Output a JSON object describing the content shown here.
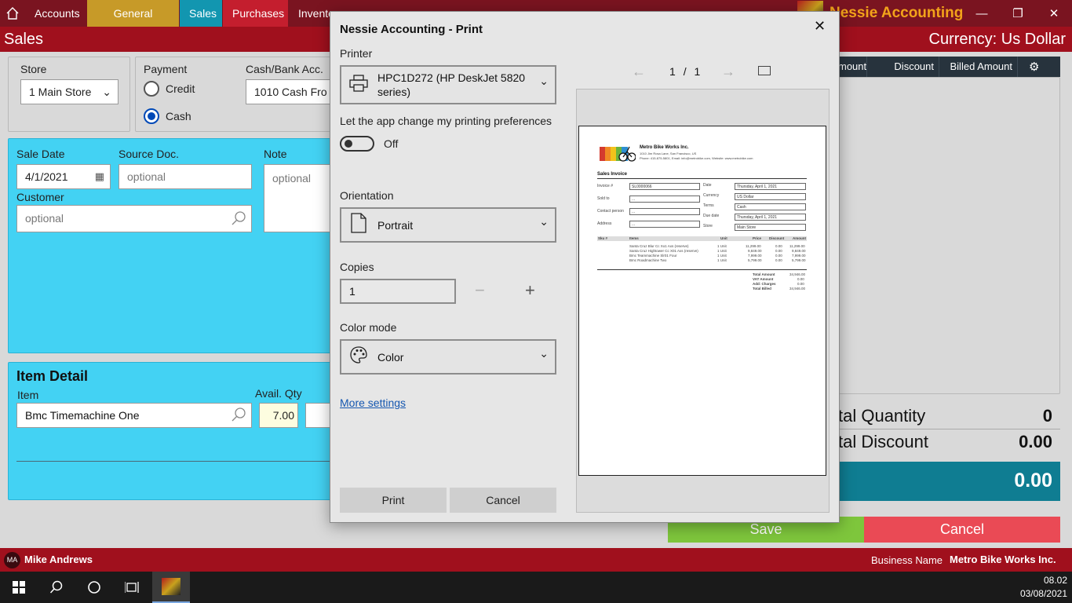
{
  "nav": {
    "items": [
      {
        "label": "Accounts",
        "bg": "#7a1420"
      },
      {
        "label": "General Journal",
        "bg": "#c79a28"
      },
      {
        "label": "Sales",
        "bg": "#1296b0"
      },
      {
        "label": "Purchases",
        "bg": "#c41e2e"
      },
      {
        "label": "Invento",
        "bg": "#7a1420"
      }
    ],
    "brand": "Nessie Accounting"
  },
  "header": {
    "title": "Sales",
    "currency": "Currency: Us Dollar"
  },
  "store": {
    "label": "Store",
    "value": "1  Main Store"
  },
  "payment": {
    "label": "Payment",
    "credit": "Credit",
    "cash": "Cash",
    "cash_acc_label": "Cash/Bank Acc.",
    "cash_acc_value": "1010   Cash Fro"
  },
  "sale": {
    "date_label": "Sale Date",
    "date_value": "4/1/2021",
    "source_label": "Source Doc.",
    "source_placeholder": "optional",
    "note_label": "Note",
    "note_placeholder": "optional",
    "customer_label": "Customer",
    "customer_placeholder": "optional"
  },
  "item_detail": {
    "title": "Item Detail",
    "item_label": "Item",
    "item_value": "Bmc Timemachine One",
    "avail_label": "Avail. Qty",
    "avail_value": "7.00"
  },
  "grid": {
    "headers": [
      "mount",
      "Discount",
      "Billed Amount"
    ]
  },
  "totals": {
    "qty_label": "tal Quantity",
    "qty_value": "0",
    "disc_label": "tal Discount",
    "disc_value": "0.00",
    "grand_value": "0.00"
  },
  "actions": {
    "save": "Save",
    "cancel": "Cancel"
  },
  "status": {
    "initials": "MA",
    "user": "Mike Andrews",
    "business_label": "Business Name",
    "business_value": "Metro Bike Works Inc."
  },
  "taskbar": {
    "time": "08.02",
    "date": "03/08/2021"
  },
  "dialog": {
    "title": "Nessie Accounting - Print",
    "printer_label": "Printer",
    "printer_value_line1": "HPC1D272 (HP DeskJet 5820",
    "printer_value_line2": "series)",
    "pref_label": "Let the app change my printing preferences",
    "pref_state": "Off",
    "orientation_label": "Orientation",
    "orientation_value": "Portrait",
    "copies_label": "Copies",
    "copies_value": "1",
    "color_label": "Color mode",
    "color_value": "Color",
    "more_settings": "More settings",
    "print_button": "Print",
    "cancel_button": "Cancel",
    "page_current": "1",
    "page_sep": "/",
    "page_total": "1"
  },
  "invoice": {
    "company": "Metro Bike Works Inc.",
    "address": "1010 Jim Rosa Lane, San Francisco, US",
    "contact": "Phone: 415-875-5801, Email: info@metrobike.com, Website: www.metrobike.com",
    "doc_title": "Sales Invoice",
    "left_labels": [
      "Invoice #",
      "Sold to",
      "Contact person",
      "Address"
    ],
    "left_values": [
      "SL0000066",
      "...",
      "...",
      "..."
    ],
    "right_labels": [
      "Date",
      "Currency",
      "Terms",
      "Due date",
      "Store"
    ],
    "right_values": [
      "Thursday, April 1, 2021",
      "US Dollar",
      "Cash",
      "Thursday, April 1, 2021",
      "Main Store"
    ],
    "table_headers": [
      "Sku #",
      "Items",
      "Unit",
      "Price",
      "Discount",
      "Amount"
    ],
    "rows": [
      [
        "",
        "Santa Cruz Blur Cc Xo1 Axs (reserve)",
        "1 Unit",
        "11,299.00",
        "0.00",
        "11,299.00"
      ],
      [
        "",
        "Santa Cruz Hightower Cc X01 Axs (reserve)",
        "1 Unit",
        "9,849.00",
        "0.00",
        "9,849.00"
      ],
      [
        "",
        "Bmc Teammachine Slr01 Four",
        "1 Unit",
        "7,999.00",
        "0.00",
        "7,999.00"
      ],
      [
        "",
        "Bmc Roadmachine Two",
        "1 Unit",
        "5,799.00",
        "0.00",
        "5,799.00"
      ]
    ],
    "summary_labels": [
      "Total Amount",
      "VAT Amount",
      "Add: Charges",
      "Total Billed"
    ],
    "summary_values": [
      "34,946.00",
      "0.00",
      "0.00",
      "34,946.00"
    ]
  }
}
